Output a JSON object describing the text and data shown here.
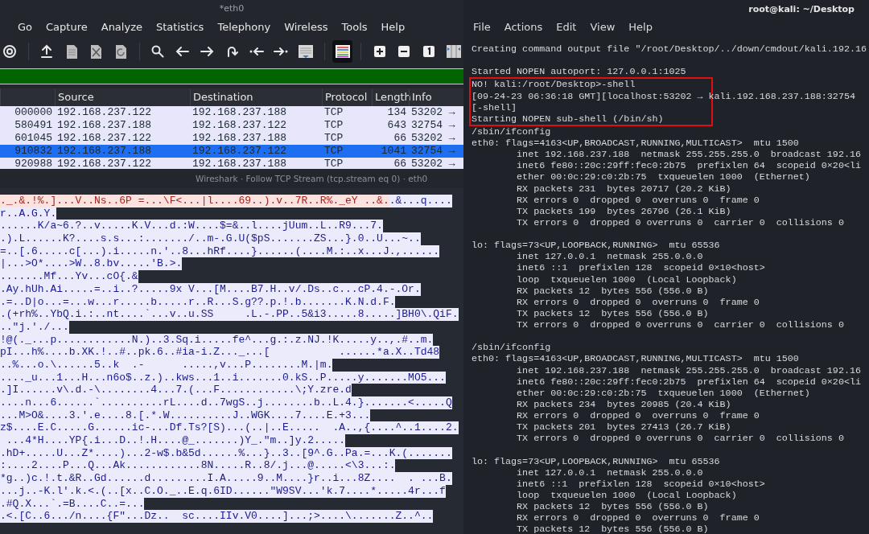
{
  "wireshark": {
    "title": "*eth0",
    "menu": [
      "Go",
      "Capture",
      "Analyze",
      "Statistics",
      "Telephony",
      "Wireless",
      "Tools",
      "Help"
    ],
    "toolbar": [
      {
        "kind": "gear",
        "on": false
      },
      {
        "kind": "open",
        "on": false
      },
      {
        "kind": "file",
        "on": false
      },
      {
        "kind": "close",
        "on": false
      },
      {
        "kind": "reload",
        "on": false
      },
      {
        "kind": "search",
        "on": false
      },
      {
        "kind": "back",
        "on": false
      },
      {
        "kind": "forward",
        "on": false
      },
      {
        "kind": "jump",
        "on": false
      },
      {
        "kind": "first",
        "on": false
      },
      {
        "kind": "last",
        "on": false
      },
      {
        "kind": "autoscroll",
        "on": false
      },
      {
        "kind": "colorize",
        "on": true
      },
      {
        "kind": "zoom-in",
        "on": false
      },
      {
        "kind": "zoom-out",
        "on": false
      },
      {
        "kind": "normal-size",
        "on": false
      },
      {
        "kind": "resize",
        "on": false
      }
    ],
    "packet_list": {
      "columns": [
        "",
        "Source",
        "Destination",
        "Protocol",
        "Length",
        "Info"
      ],
      "rows": [
        {
          "cells": [
            "000000",
            "192.168.237.122",
            "192.168.237.188",
            "TCP",
            "134",
            "53202 →"
          ],
          "selected": false
        },
        {
          "cells": [
            "580491",
            "192.168.237.188",
            "192.168.237.122",
            "TCP",
            "643",
            "32754 →"
          ],
          "selected": false
        },
        {
          "cells": [
            "601045",
            "192.168.237.122",
            "192.168.237.188",
            "TCP",
            "66",
            "53202 →"
          ],
          "selected": false
        },
        {
          "cells": [
            "910832",
            "192.168.237.188",
            "192.168.237.122",
            "TCP",
            "1041",
            "32754 →"
          ],
          "selected": true
        },
        {
          "cells": [
            "920988",
            "192.168.237.122",
            "192.168.237.188",
            "TCP",
            "66",
            "53202 →"
          ],
          "selected": false
        }
      ]
    },
    "stream_title": "Wireshark · Follow TCP Stream (tcp.stream eq 0) · eth0",
    "stream": [
      [
        {
          "kind": "client",
          "text": "._.&.!%.]...V..Ns..6P =...\\F<...|l....69..).v..7R..R%._eY ..&."
        },
        {
          "kind": "server",
          "text": ".&...q...."
        }
      ],
      [
        {
          "kind": "server",
          "text": "r..A.G.Y."
        }
      ],
      [
        {
          "kind": "server",
          "text": "......K/a~6.?..v.....K.V...d.:W....$=&..l....jUum..L..R9...7."
        }
      ],
      [
        {
          "kind": "server",
          "text": ".).L......K?....s.s...:......./..m-.G.U($pS.......ZS...}.0..U...~.."
        }
      ],
      [
        {
          "kind": "server",
          "text": "=..[.6.....c[...).i.....n.'..8...hRf....}......(....M.:..x...J.,......"
        }
      ],
      [
        {
          "kind": "server",
          "text": "|...>O*....>W..8.bv.....'B.>."
        }
      ],
      [
        {
          "kind": "server",
          "text": ".......Mf...Yv...cO{.&"
        }
      ],
      [
        {
          "kind": "server",
          "text": ".Ay.hUh.Ai.....=..i..?.....9x V...[M....B7.H..v/.Ds..c...cP.4.-.Or."
        }
      ],
      [
        {
          "kind": "server",
          "text": ".=..D|o...=...w...r.....b.....r..R...S.g??.p.!.b.......K.N.d.F."
        }
      ],
      [
        {
          "kind": "server",
          "text": ".(+rh%..YbQ.i.:..nt....`...v..u.SS     .L.-.PP..5&i3.....8.....]BH0\\.QiF."
        }
      ],
      [
        {
          "kind": "server",
          "text": "..\"j.'./..."
        }
      ],
      [
        {
          "kind": "server",
          "text": "!@(._...p............N.)..3.Sq.i.....fe^...g.:.z.NJ.!K.....y..,.#..m."
        }
      ],
      [
        {
          "kind": "server",
          "text": "pI...h%....b.XK.!..#..pk.6..#ia-i.Z..._...[           ......*a.X..Td48"
        }
      ],
      [
        {
          "kind": "server",
          "text": "..%...o.\\......5..k  .-      .....,v...P........M.|m."
        }
      ],
      [
        {
          "kind": "server",
          "text": "...._u...1...H...n6o$..z.)..kws...1..i.......0.kS..P.....y.......MO5..."
        }
      ],
      [
        {
          "kind": "server",
          "text": ".]I......v\\.d.-\\........4...7.(...F............\\;Y.zre.d"
        }
      ],
      [
        {
          "kind": "server",
          "text": "....n...6......`..........rL....d..7wgS..j........b..L.4.}.......<.....Q"
        }
      ],
      [
        {
          "kind": "server",
          "text": "...M>O&....3.'.e....8.[.*.W..........J..WGK....7....E.+3..."
        }
      ],
      [
        {
          "kind": "server",
          "text": "z$....E.C.....G......ic-...Df.Ts?[S)...(..|..E.....  .A..,{....^..1....2."
        }
      ],
      [
        {
          "kind": "server",
          "text": " ...4*H....YP{.i...D..!.H....@_.......)Y_.\"m..]y.2....."
        }
      ],
      [
        {
          "kind": "server",
          "text": ".hD+.....U...Z*....)...2-w$.b&5d......%...}..3..[9^.G..Pa.=...K.(......."
        }
      ],
      [
        {
          "kind": "server",
          "text": ":....2....P...Q...Ak............8N.....R..8/.j...@.....<\\3...:."
        }
      ],
      [
        {
          "kind": "server",
          "text": "*g..)c.!.t.&R..Gd......d.........I.A.....9..M....}r..i...8Z....  . ...B."
        }
      ],
      [
        {
          "kind": "server",
          "text": "...j..-K.l'.k.<.(..[x..C.O._..E.q.6ID......\"W9SV...'k.7....*.....4r...f"
        }
      ],
      [
        {
          "kind": "server",
          "text": ".#Q.X...`.=B....C..=..."
        }
      ],
      [
        {
          "kind": "server",
          "text": ".<.[C..6.../n....{F\"...Dz..  sc....IIv.V0....]...;>....\\.......Z..^.."
        }
      ]
    ]
  },
  "terminal": {
    "title": "root@kali: ~/Desktop",
    "menu": [
      "File",
      "Actions",
      "Edit",
      "View",
      "Help"
    ],
    "blocks_before": [
      [
        "Creating command output file \"/root/Desktop/../down/cmdout/kali.192.16"
      ],
      [
        "Started NOPEN autoport: 127.0.0.1:1025"
      ]
    ],
    "highlight_box": [
      "NO! kali:/root/Desktop>-shell",
      "[09-24-23 06:36:18 GMT][localhost:53202 → kali.192.168.237.188:32754",
      "[-shell]",
      "Starting NOPEN sub-shell (/bin/sh)"
    ],
    "blocks_after": [
      [
        "/sbin/ifconfig",
        "eth0: flags=4163<UP,BROADCAST,RUNNING,MULTICAST>  mtu 1500",
        "        inet 192.168.237.188  netmask 255.255.255.0  broadcast 192.16",
        "        inet6 fe80::20c:29ff:fec0:2b75  prefixlen 64  scopeid 0×20<li",
        "        ether 00:0c:29:c0:2b:75  txqueuelen 1000  (Ethernet)",
        "        RX packets 231  bytes 20717 (20.2 KiB)",
        "        RX errors 0  dropped 0  overruns 0  frame 0",
        "        TX packets 199  bytes 26796 (26.1 KiB)",
        "        TX errors 0  dropped 0 overruns 0  carrier 0  collisions 0"
      ],
      [
        "lo: flags=73<UP,LOOPBACK,RUNNING>  mtu 65536",
        "        inet 127.0.0.1  netmask 255.0.0.0",
        "        inet6 ::1  prefixlen 128  scopeid 0×10<host>",
        "        loop  txqueuelen 1000  (Local Loopback)",
        "        RX packets 12  bytes 556 (556.0 B)",
        "        RX errors 0  dropped 0  overruns 0  frame 0",
        "        TX packets 12  bytes 556 (556.0 B)",
        "        TX errors 0  dropped 0 overruns 0  carrier 0  collisions 0"
      ],
      [
        "/sbin/ifconfig",
        "eth0: flags=4163<UP,BROADCAST,RUNNING,MULTICAST>  mtu 1500",
        "        inet 192.168.237.188  netmask 255.255.255.0  broadcast 192.16",
        "        inet6 fe80::20c:29ff:fec0:2b75  prefixlen 64  scopeid 0×20<li",
        "        ether 00:0c:29:c0:2b:75  txqueuelen 1000  (Ethernet)",
        "        RX packets 234  bytes 20985 (20.4 KiB)",
        "        RX errors 0  dropped 0  overruns 0  frame 0",
        "        TX packets 201  bytes 27413 (26.7 KiB)",
        "        TX errors 0  dropped 0 overruns 0  carrier 0  collisions 0"
      ],
      [
        "lo: flags=73<UP,LOOPBACK,RUNNING>  mtu 65536",
        "        inet 127.0.0.1  netmask 255.0.0.0",
        "        inet6 ::1  prefixlen 128  scopeid 0×10<host>",
        "        loop  txqueuelen 1000  (Local Loopback)",
        "        RX packets 12  bytes 556 (556.0 B)",
        "        RX errors 0  dropped 0  overruns 0  frame 0",
        "        TX packets 12  bytes 556 (556.0 B)"
      ]
    ]
  }
}
